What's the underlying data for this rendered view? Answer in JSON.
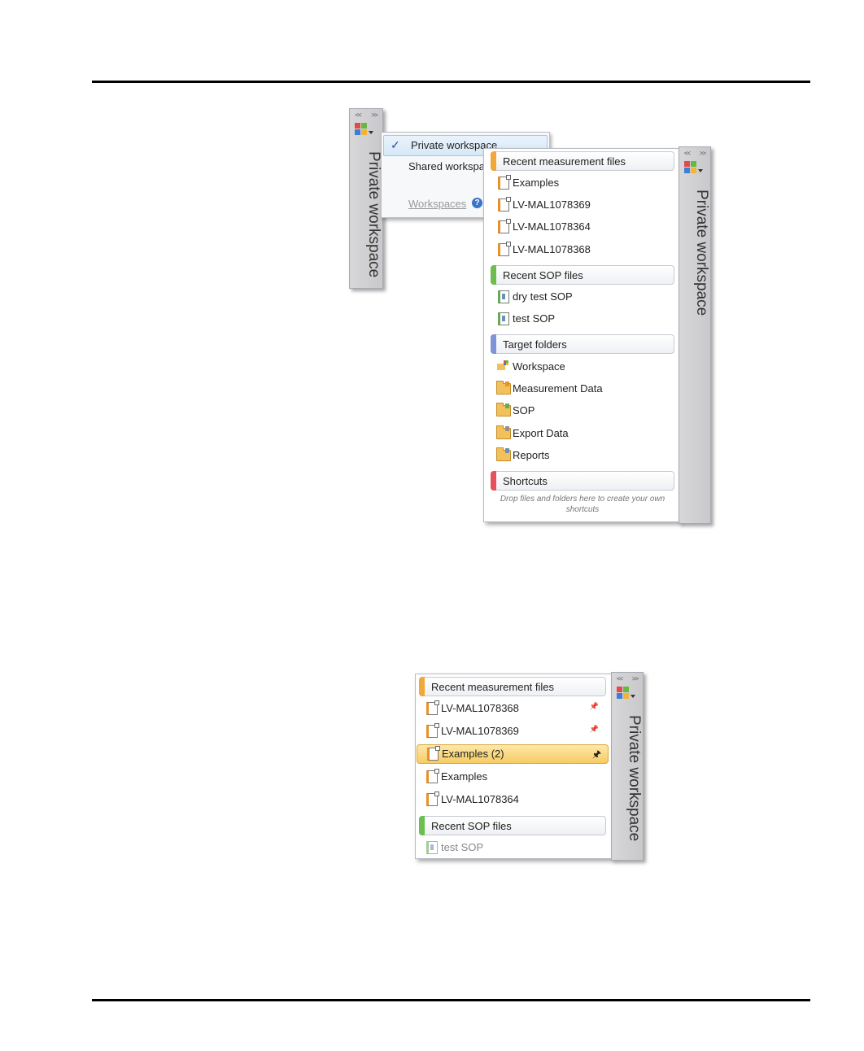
{
  "colors": {
    "measurement_accent": "#f2a838",
    "sop_accent": "#6cbf4f",
    "target_accent": "#7f93d8",
    "shortcut_accent": "#e8505b",
    "highlight": "#f7cc64"
  },
  "small_tab": {
    "nav_prev": "<<",
    "nav_next": ">>",
    "title": "Private workspace"
  },
  "menu": {
    "items": [
      {
        "label": "Private workspace",
        "checked": true
      },
      {
        "label": "Shared workspace",
        "checked": false
      }
    ],
    "check_mark": "✓",
    "footer_link": "Workspaces",
    "help_glyph": "?"
  },
  "panel1": {
    "tab": {
      "nav_prev": "<<",
      "nav_next": ">>",
      "title": "Private workspace"
    },
    "sections": {
      "recent_measurement": {
        "title": "Recent measurement files",
        "items": [
          "Examples",
          "LV-MAL1078369",
          "LV-MAL1078364",
          "LV-MAL1078368"
        ]
      },
      "recent_sop": {
        "title": "Recent SOP files",
        "items": [
          "dry test SOP",
          "test SOP"
        ]
      },
      "target_folders": {
        "title": "Target folders",
        "items": [
          "Workspace",
          "Measurement Data",
          "SOP",
          "Export Data",
          "Reports"
        ]
      },
      "shortcuts": {
        "title": "Shortcuts",
        "hint_line1": "Drop files and folders here to create your own",
        "hint_line2": "shortcuts"
      }
    }
  },
  "panel2": {
    "tab": {
      "nav_prev": "<<",
      "nav_next": ">>",
      "title": "Private workspace"
    },
    "sections": {
      "recent_measurement": {
        "title": "Recent measurement files",
        "items": [
          {
            "label": "LV-MAL1078368",
            "pinned": true
          },
          {
            "label": "LV-MAL1078369",
            "pinned": true
          },
          {
            "label": "Examples (2)",
            "pinned": true,
            "highlighted": true
          },
          {
            "label": "Examples",
            "pinned": false
          },
          {
            "label": "LV-MAL1078364",
            "pinned": false
          }
        ]
      },
      "recent_sop": {
        "title": "Recent SOP files",
        "items": [
          "test SOP"
        ]
      }
    }
  },
  "icons": {
    "pin_glyph": "📌",
    "pinned_glyph": "🖈"
  }
}
